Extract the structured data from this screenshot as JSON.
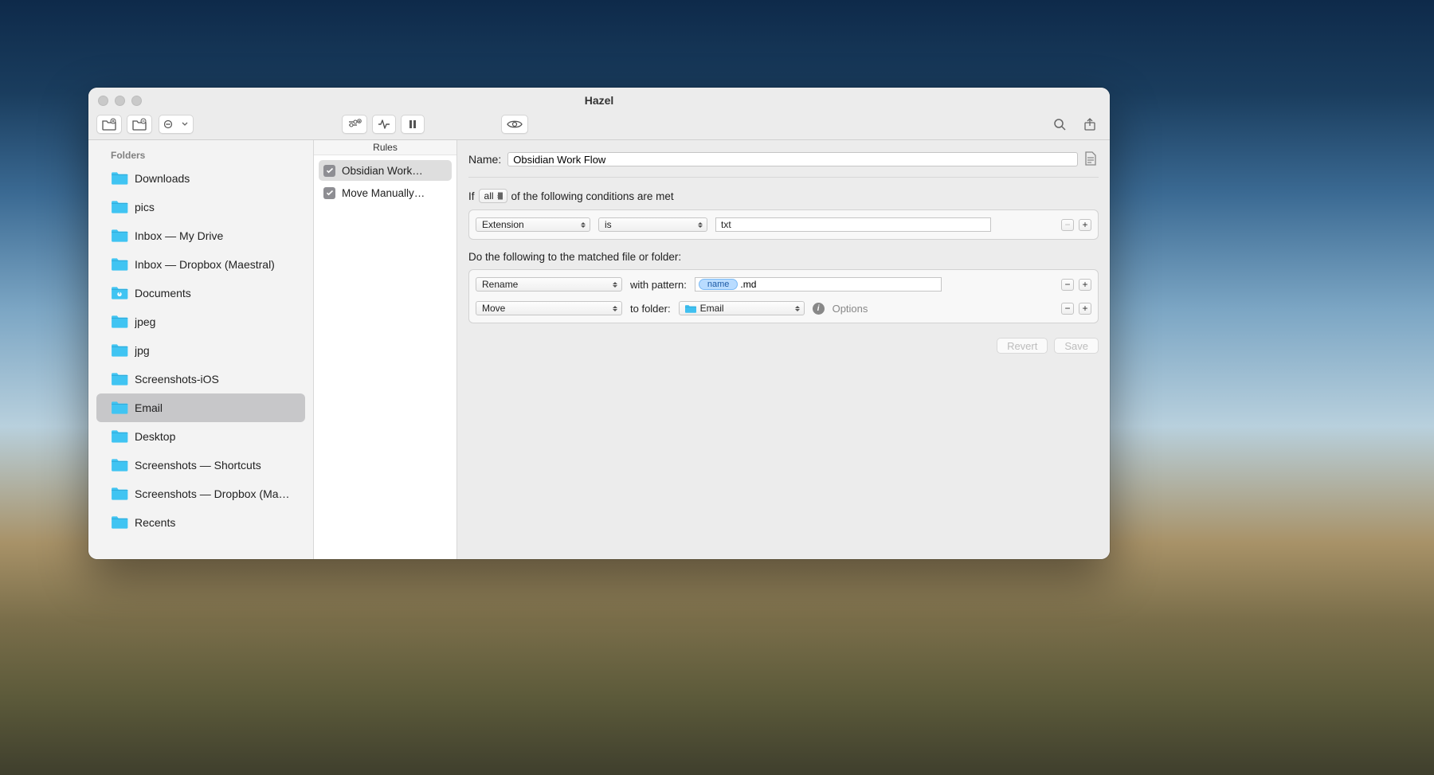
{
  "window": {
    "title": "Hazel"
  },
  "sidebar": {
    "header": "Folders",
    "items": [
      {
        "label": "Downloads",
        "special": false
      },
      {
        "label": "pics",
        "special": false
      },
      {
        "label": "Inbox — My Drive",
        "special": false
      },
      {
        "label": "Inbox — Dropbox (Maestral)",
        "special": false
      },
      {
        "label": "Documents",
        "special": true
      },
      {
        "label": "jpeg",
        "special": false
      },
      {
        "label": "jpg",
        "special": false
      },
      {
        "label": "Screenshots-iOS",
        "special": false
      },
      {
        "label": "Email",
        "special": false,
        "selected": true
      },
      {
        "label": "Desktop",
        "special": false
      },
      {
        "label": "Screenshots — Shortcuts",
        "special": false
      },
      {
        "label": "Screenshots — Dropbox (Ma…",
        "special": false
      },
      {
        "label": "Recents",
        "special": false
      }
    ]
  },
  "rules": {
    "header": "Rules",
    "items": [
      {
        "label": "Obsidian Work…",
        "checked": true,
        "selected": true
      },
      {
        "label": "Move Manually…",
        "checked": true,
        "selected": false
      }
    ]
  },
  "detail": {
    "name_label": "Name:",
    "name_value": "Obsidian Work Flow",
    "cond_prefix": "If",
    "cond_mode": "all",
    "cond_suffix": "of the following conditions are met",
    "condition": {
      "attribute": "Extension",
      "operator": "is",
      "value": "txt"
    },
    "actions_header": "Do the following to the matched file or folder:",
    "actions": {
      "rename": {
        "action": "Rename",
        "label": "with pattern:",
        "token": "name",
        "suffix": ".md"
      },
      "move": {
        "action": "Move",
        "label": "to folder:",
        "folder": "Email",
        "options_label": "Options"
      }
    },
    "buttons": {
      "revert": "Revert",
      "save": "Save"
    }
  }
}
